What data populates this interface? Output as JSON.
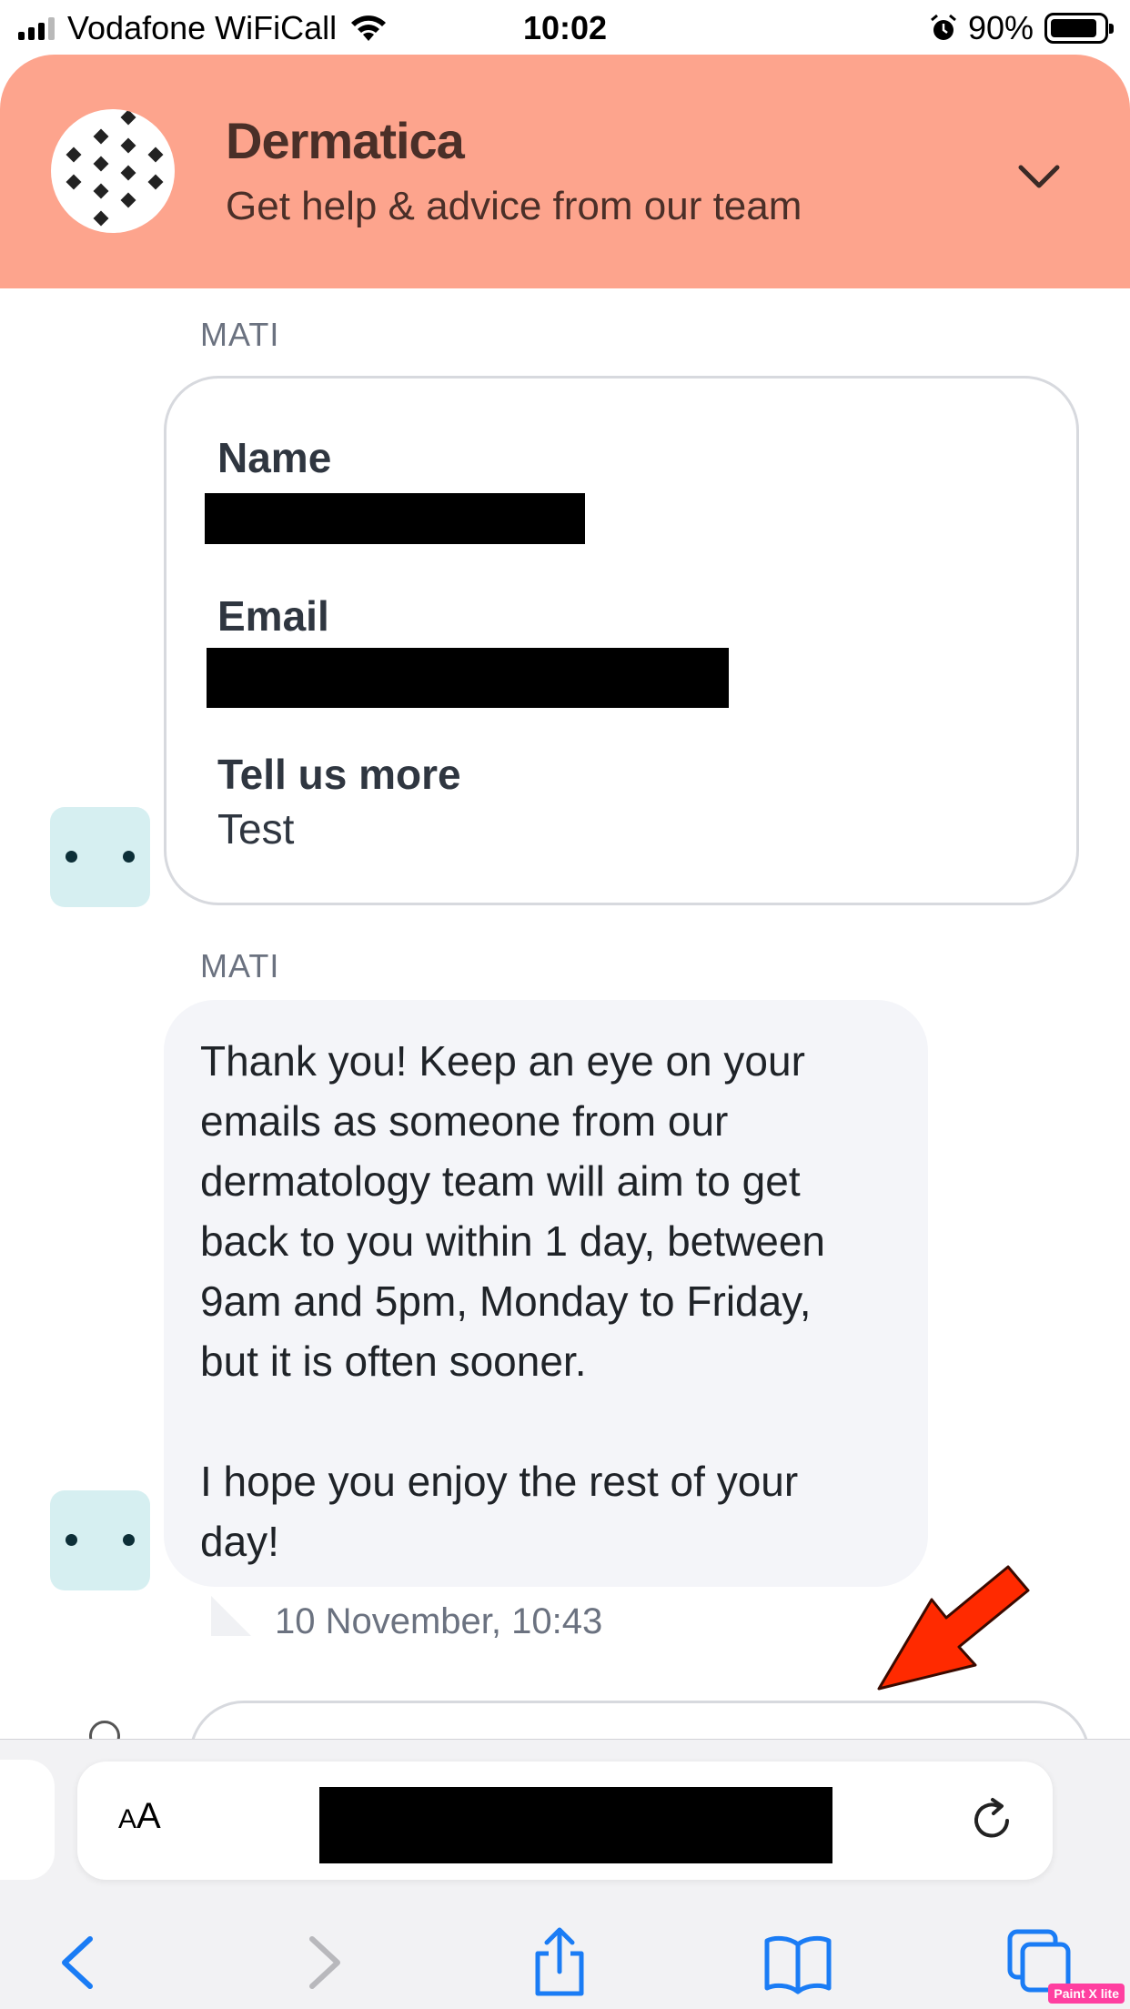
{
  "status_bar": {
    "carrier": "Vodafone WiFiCall",
    "time": "10:02",
    "battery": "90%",
    "battery_level": 0.9
  },
  "header": {
    "brand": "Dermatica",
    "tagline": "Get help & advice from our team",
    "background_color": "#fda48d",
    "collapse_icon": "chevron-down-icon"
  },
  "messages": [
    {
      "sender": "MATI",
      "form": {
        "fields": [
          {
            "label": "Name",
            "value": ""
          },
          {
            "label": "Email",
            "value": ""
          },
          {
            "label": "Tell us more",
            "value": "Test"
          }
        ]
      }
    },
    {
      "sender": "MATI",
      "lines": [
        "Thank you! Keep an eye on your",
        "emails as someone from our",
        "dermatology team will aim to get",
        "back to you within 1 day, between",
        "9am and 5pm, Monday to Friday,",
        "but it is often sooner.",
        "",
        "I hope you enjoy the rest of your",
        "day!"
      ],
      "timestamp": "10 November, 10:43"
    }
  ],
  "safari": {
    "text_size_label_small": "A",
    "text_size_label_large": "A",
    "icons": [
      "back-icon",
      "forward-icon",
      "share-icon",
      "bookmarks-icon",
      "tabs-icon",
      "reload-icon"
    ],
    "watermark": "Paint X lite"
  }
}
